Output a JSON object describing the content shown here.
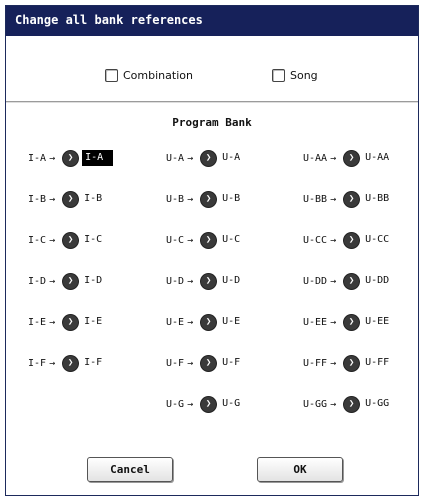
{
  "dialog": {
    "title": "Change all bank references"
  },
  "options": {
    "combination_label": "Combination",
    "song_label": "Song"
  },
  "section": {
    "title": "Program Bank"
  },
  "mappings": {
    "column1": [
      {
        "src": "I-A",
        "dst": "I-A",
        "selected": true
      },
      {
        "src": "I-B",
        "dst": "I-B"
      },
      {
        "src": "I-C",
        "dst": "I-C"
      },
      {
        "src": "I-D",
        "dst": "I-D"
      },
      {
        "src": "I-E",
        "dst": "I-E"
      },
      {
        "src": "I-F",
        "dst": "I-F"
      }
    ],
    "column2": [
      {
        "src": "U-A",
        "dst": "U-A"
      },
      {
        "src": "U-B",
        "dst": "U-B"
      },
      {
        "src": "U-C",
        "dst": "U-C"
      },
      {
        "src": "U-D",
        "dst": "U-D"
      },
      {
        "src": "U-E",
        "dst": "U-E"
      },
      {
        "src": "U-F",
        "dst": "U-F"
      },
      {
        "src": "U-G",
        "dst": "U-G"
      }
    ],
    "column3": [
      {
        "src": "U-AA",
        "dst": "U-AA"
      },
      {
        "src": "U-BB",
        "dst": "U-BB"
      },
      {
        "src": "U-CC",
        "dst": "U-CC"
      },
      {
        "src": "U-DD",
        "dst": "U-DD"
      },
      {
        "src": "U-EE",
        "dst": "U-EE"
      },
      {
        "src": "U-FF",
        "dst": "U-FF"
      },
      {
        "src": "U-GG",
        "dst": "U-GG"
      }
    ],
    "arrow_glyph": "→",
    "knob_glyph": "❯"
  },
  "buttons": {
    "cancel_label": "Cancel",
    "ok_label": "OK"
  }
}
